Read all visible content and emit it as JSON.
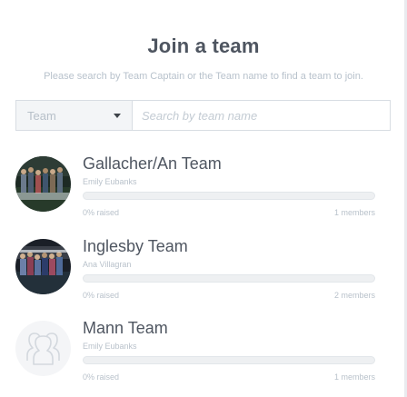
{
  "header": {
    "title": "Join a team",
    "subtitle": "Please search by Team Captain or the Team name to find a team to join."
  },
  "search": {
    "filter_selected": "Team",
    "placeholder": "Search by team name"
  },
  "teams": [
    {
      "name": "Gallacher/An Team",
      "captain": "Emily Eubanks",
      "progress": 0,
      "raised_label": "0% raised",
      "members_label": "1 members",
      "avatar": "team-photo"
    },
    {
      "name": "Inglesby Team",
      "captain": "Ana Villagran",
      "progress": 0,
      "raised_label": "0% raised",
      "members_label": "2 members",
      "avatar": "team-photo"
    },
    {
      "name": "Mann Team",
      "captain": "Emily Eubanks",
      "progress": 0,
      "raised_label": "0% raised",
      "members_label": "1 members",
      "avatar": "group-placeholder-icon"
    }
  ],
  "colors": {
    "text_dark": "#4f5661",
    "text_muted": "#b9c2cb",
    "bar_track": "#eef0f2",
    "bar_fill": "#8dc63f"
  }
}
